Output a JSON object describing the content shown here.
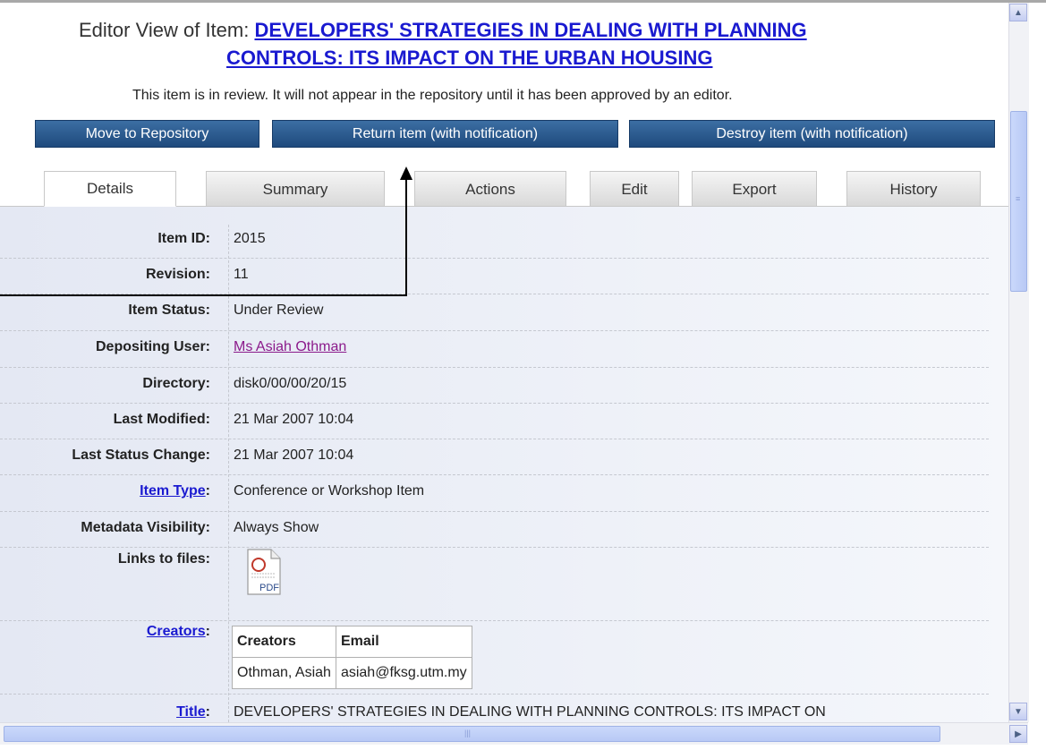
{
  "header": {
    "prefix": "Editor View of Item:",
    "title_line1": "DEVELOPERS' STRATEGIES IN DEALING WITH PLANNING",
    "title_line2": "CONTROLS: ITS IMPACT ON THE URBAN HOUSING",
    "notice": "This item is in review. It will not appear in the repository until it has been approved by an editor."
  },
  "buttons": {
    "move": "Move to Repository",
    "return": "Return item (with notification)",
    "destroy": "Destroy item (with notification)"
  },
  "tabs": [
    {
      "label": "Details",
      "active": true
    },
    {
      "label": "Summary"
    },
    {
      "label": "Actions"
    },
    {
      "label": "Edit"
    },
    {
      "label": "Export"
    },
    {
      "label": "History"
    }
  ],
  "details": {
    "item_id": {
      "label": "Item ID:",
      "value": "2015"
    },
    "revision": {
      "label": "Revision:",
      "value": "11"
    },
    "status": {
      "label": "Item Status:",
      "value": "Under Review"
    },
    "depositor": {
      "label": "Depositing User:",
      "value": "Ms Asiah Othman"
    },
    "directory": {
      "label": "Directory:",
      "value": "disk0/00/00/20/15"
    },
    "last_modified": {
      "label": "Last Modified:",
      "value": "21 Mar 2007 10:04"
    },
    "last_status": {
      "label": "Last Status Change:",
      "value": "21 Mar 2007 10:04"
    },
    "item_type": {
      "label": "Item Type",
      "value": "Conference or Workshop Item"
    },
    "visibility": {
      "label": "Metadata Visibility:",
      "value": "Always Show"
    },
    "links": {
      "label": "Links to files:",
      "file_label": "PDF"
    },
    "creators": {
      "label": "Creators",
      "headers": [
        "Creators",
        "Email"
      ],
      "rows": [
        [
          "Othman, Asiah",
          "asiah@fksg.utm.my"
        ]
      ]
    },
    "title": {
      "label": "Title",
      "value": "DEVELOPERS' STRATEGIES IN DEALING WITH PLANNING CONTROLS: ITS IMPACT ON"
    }
  },
  "colors": {
    "button": "#2b5a8e",
    "link": "#1a1ad0",
    "visited_link": "#8b1a8b",
    "scrollbar": "#c4cdf2"
  },
  "icons": {
    "scroll_up": "chevron-up-icon",
    "scroll_down": "chevron-down-icon",
    "scroll_right": "chevron-right-icon",
    "file": "pdf-file-icon"
  }
}
